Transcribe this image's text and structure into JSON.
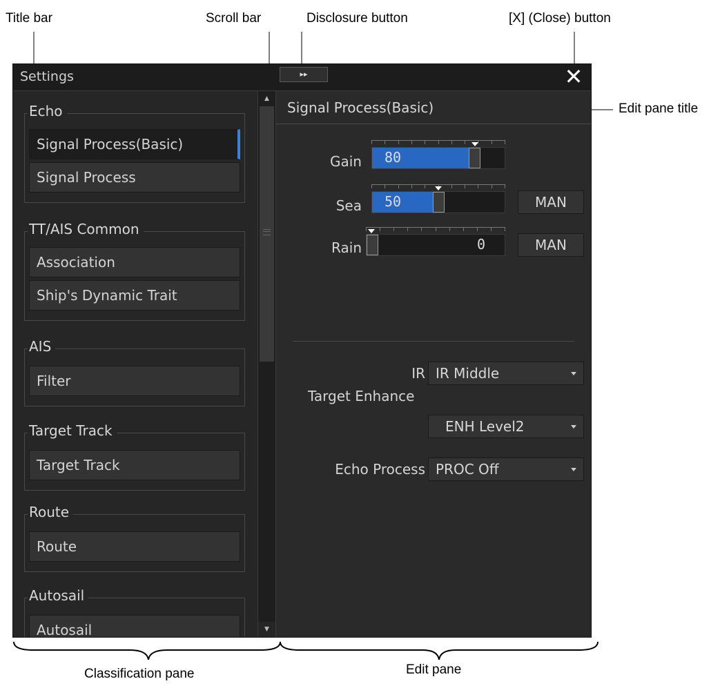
{
  "annotations": {
    "title_bar": "Title bar",
    "scroll_bar": "Scroll bar",
    "disclosure_button": "Disclosure button",
    "close_button": "[X] (Close) button",
    "edit_pane_title": "Edit pane title",
    "classification_pane": "Classification pane",
    "edit_pane": "Edit pane"
  },
  "window": {
    "title": "Settings",
    "disclosure_glyph": "▸▸",
    "close_glyph": "✕"
  },
  "classification": {
    "groups": [
      {
        "title": "Echo",
        "items": [
          "Signal Process(Basic)",
          "Signal Process"
        ],
        "selected": 0
      },
      {
        "title": "TT/AIS Common",
        "items": [
          "Association",
          "Ship's Dynamic Trait"
        ]
      },
      {
        "title": "AIS",
        "items": [
          "Filter"
        ]
      },
      {
        "title": "Target Track",
        "items": [
          "Target Track"
        ]
      },
      {
        "title": "Route",
        "items": [
          "Route"
        ]
      },
      {
        "title": "Autosail",
        "items": [
          "Autosail"
        ]
      }
    ]
  },
  "scrollbar": {
    "up_glyph": "▲",
    "down_glyph": "▼"
  },
  "edit": {
    "title": "Signal Process(Basic)",
    "gain": {
      "label": "Gain",
      "value": "80",
      "level": 80
    },
    "sea": {
      "label": "Sea",
      "value": "50",
      "level": 50,
      "mode": "MAN"
    },
    "rain": {
      "label": "Rain",
      "value": "0",
      "level": 0,
      "mode": "MAN"
    },
    "ir": {
      "label": "IR",
      "value": "IR Middle"
    },
    "target_enhance": {
      "label": "Target Enhance",
      "value": "ENH Level2"
    },
    "echo_process": {
      "label": "Echo Process",
      "value": "PROC Off"
    }
  },
  "colors": {
    "accent": "#2968c2",
    "background": "#2b2b2b",
    "selected_marker": "#3a82d8"
  }
}
